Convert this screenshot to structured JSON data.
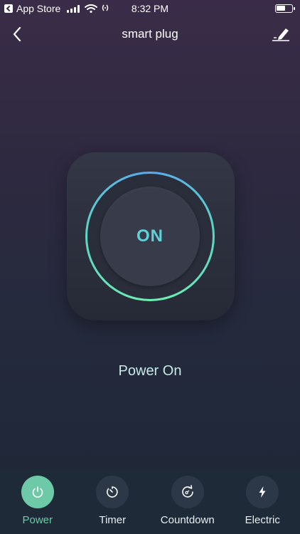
{
  "status_bar": {
    "back_app": "App Store",
    "time": "8:32 PM"
  },
  "nav": {
    "title": "smart plug",
    "back_icon": "chevron-left-icon",
    "edit_icon": "pencil-icon"
  },
  "switch": {
    "state_label": "ON",
    "ring_colors": [
      "#5aa9ef",
      "#6ff0b0"
    ]
  },
  "status_text": "Power On",
  "tabs": [
    {
      "label": "Power",
      "icon": "power-icon",
      "active": true
    },
    {
      "label": "Timer",
      "icon": "timer-icon",
      "active": false
    },
    {
      "label": "Countdown",
      "icon": "countdown-icon",
      "active": false
    },
    {
      "label": "Electric",
      "icon": "lightning-icon",
      "active": false
    }
  ],
  "colors": {
    "accent": "#6ec9a8",
    "on_text": "#5fd2d6",
    "tab_bg": "#1e2a38"
  }
}
